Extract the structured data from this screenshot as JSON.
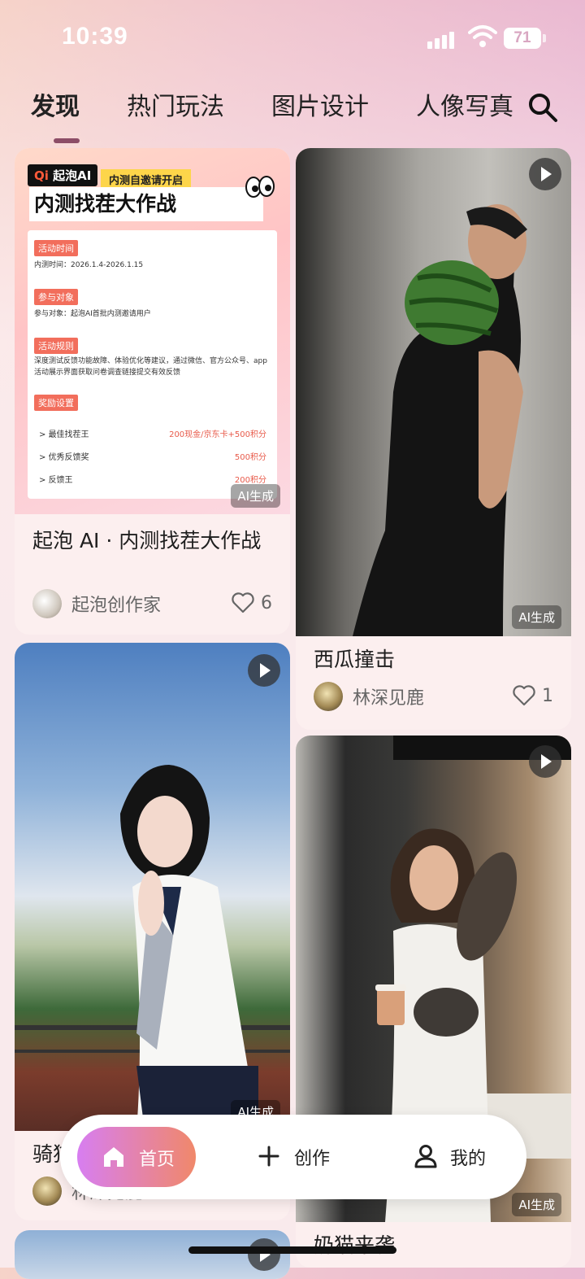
{
  "status_bar": {
    "time": "10:39",
    "battery": "71"
  },
  "tabs": [
    {
      "label": "发现",
      "active": true
    },
    {
      "label": "热门玩法",
      "active": false
    },
    {
      "label": "图片设计",
      "active": false
    },
    {
      "label": "人像写真",
      "active": false
    }
  ],
  "feed": {
    "card1": {
      "title": "起泡 AI · 内测找茬大作战",
      "author": "起泡创作家",
      "likes": "6",
      "ai_tag": "AI生成",
      "poster": {
        "logo": "起泡AI",
        "tag": "内测自邀请开启",
        "title": "内测找茬大作战",
        "s1": "活动时间",
        "s1_text": "内测时间：2026.1.4-2026.1.15",
        "s2": "参与对象",
        "s2_text": "参与对象：起泡AI首批内测邀请用户",
        "s3": "活动规则",
        "s3_text": "深度测试反馈功能故障、体验优化等建议，通过微信、官方公众号、app活动展示界面获取问卷调查链接提交有效反馈",
        "s4": "奖励设置",
        "rewards": [
          {
            "name": "最佳找茬王",
            "value": "200现金/京东卡+500积分"
          },
          {
            "name": "优秀反馈奖",
            "value": "500积分"
          },
          {
            "name": "反馈王",
            "value": "200积分"
          }
        ]
      }
    },
    "card2": {
      "title": "西瓜撞击",
      "author": "林深见鹿",
      "likes": "1",
      "ai_tag": "AI生成"
    },
    "card3": {
      "title": "骑猫",
      "author": "林深见鹿",
      "ai_tag": "AI生成"
    },
    "card4": {
      "title": "奶猫来袭",
      "ai_tag": "AI生成"
    }
  },
  "nav": {
    "home": "首页",
    "create": "创作",
    "mine": "我的"
  }
}
